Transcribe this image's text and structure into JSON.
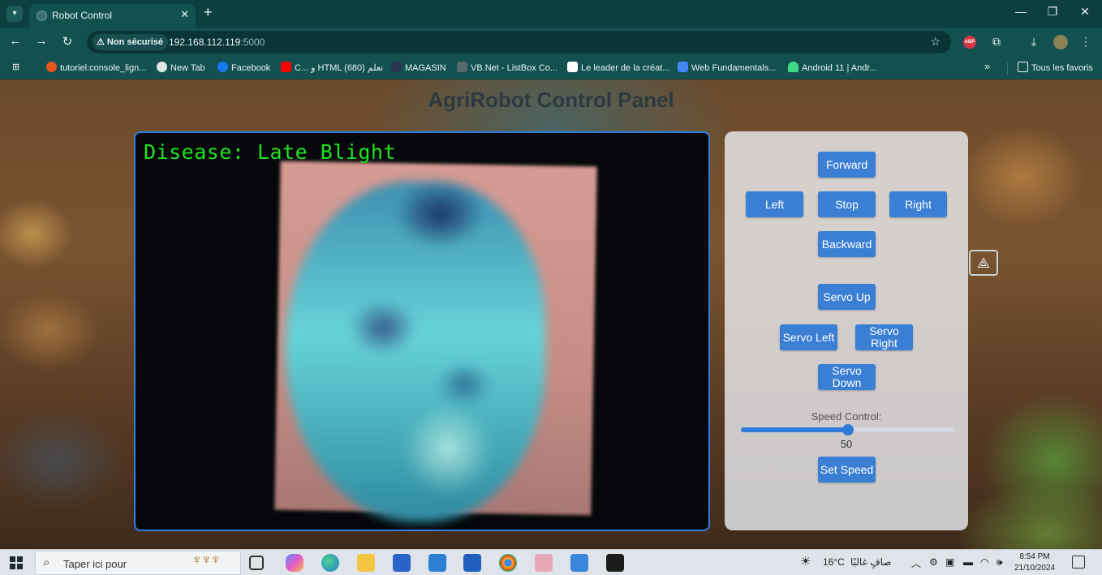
{
  "browser": {
    "tab_menu_icon": "chevron-down-icon",
    "tab_title": "Robot Control",
    "tab_close": "✕",
    "new_tab": "+",
    "window_controls": {
      "minimize": "—",
      "maximize": "❐",
      "close": "✕"
    },
    "nav": {
      "back": "←",
      "forward": "→",
      "reload": "↻"
    },
    "security_label": "Non sécurisé",
    "url_host": "192.168.112.119",
    "url_port": ":5000",
    "bookmark_star": "☆",
    "bookmarks": [
      {
        "label": "tutoriel:console_lign...",
        "color": "#e95420"
      },
      {
        "label": "New Tab",
        "color": "#dfe7e7"
      },
      {
        "label": "Facebook",
        "color": "#1877f2"
      },
      {
        "label": "C... و HTML تعلم (680)",
        "color": "#ff0000"
      },
      {
        "label": "MAGASIN",
        "color": "#2a3550"
      },
      {
        "label": "VB.Net - ListBox Co...",
        "color": "#556b6b"
      },
      {
        "label": "Le leader de la créat...",
        "color": "#ffffff"
      },
      {
        "label": "Web Fundamentals...",
        "color": "#4285f4"
      },
      {
        "label": "Android 11  |  Andr...",
        "color": "#3ddc84"
      }
    ],
    "bookmarks_overflow": "»",
    "all_bookmarks": "Tous les favoris"
  },
  "page": {
    "title": "AgriRobot Control Panel",
    "detection_text": "Disease: Late Blight",
    "controls": {
      "forward": "Forward",
      "left": "Left",
      "stop": "Stop",
      "right": "Right",
      "backward": "Backward",
      "servo_up": "Servo Up",
      "servo_left": "Servo Left",
      "servo_right": "Servo Right",
      "servo_down": "Servo Down"
    },
    "speed": {
      "label": "Speed Control:",
      "value": "50",
      "min": 0,
      "max": 100,
      "set_label": "Set Speed"
    }
  },
  "taskbar": {
    "search_placeholder": "Taper ici pour",
    "apps": [
      "task-view",
      "copilot",
      "edge",
      "file-explorer",
      "store",
      "mail",
      "word",
      "chrome",
      "snipping-tool",
      "paint",
      "terminal"
    ],
    "weather_temp": "16°C",
    "weather_text": "صافٍ غالبًا",
    "time": "8:54 PM",
    "date": "21/10/2024"
  },
  "colors": {
    "accent": "#3a7fd4",
    "detection": "#1ee61e",
    "chrome_frame": "#0e3f40"
  }
}
